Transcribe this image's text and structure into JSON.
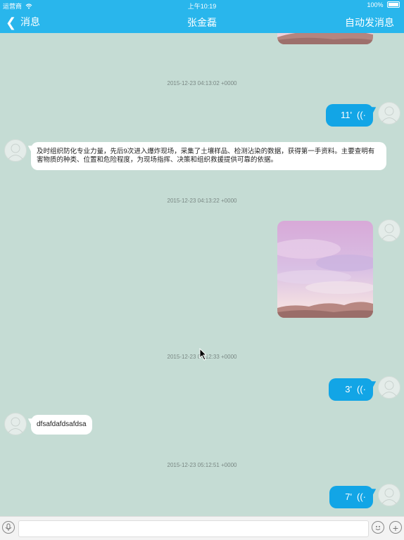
{
  "status_bar": {
    "carrier": "运营商",
    "time": "上午10:19",
    "battery": "100%"
  },
  "nav": {
    "back_label": "消息",
    "title": "张金磊",
    "right_label": "自动发消息"
  },
  "messages": [
    {
      "type": "timestamp",
      "text": "2015-12-23 04:13:02 +0000"
    },
    {
      "type": "voice",
      "direction": "out",
      "duration": "11'"
    },
    {
      "type": "text",
      "direction": "in",
      "text": "及时组织防化专业力量，先后9次进入爆炸现场，采集了土壤样品、检测沾染的数据，获得第一手资料。主要查明有害物质的种类、位置和危险程度，为现场指挥、决策和组织救援提供可靠的依据。"
    },
    {
      "type": "timestamp",
      "text": "2015-12-23 04:13:22 +0000"
    },
    {
      "type": "image",
      "direction": "out"
    },
    {
      "type": "timestamp",
      "text": "2015-12-23 04:12:33 +0000"
    },
    {
      "type": "voice",
      "direction": "out",
      "duration": "3'"
    },
    {
      "type": "text",
      "direction": "in",
      "text": "dfsafdafdsafdsa"
    },
    {
      "type": "timestamp",
      "text": "2015-12-23 05:12:51 +0000"
    },
    {
      "type": "voice",
      "direction": "out",
      "duration": "7'"
    }
  ],
  "icons": {
    "back": "chevron-left-icon",
    "wifi": "wifi-icon",
    "voice_wave": "sound-wave-icon",
    "mic": "microphone-icon",
    "emoji": "emoji-icon",
    "add": "plus-icon"
  },
  "colors": {
    "nav_bar": "#29b6ec",
    "chat_background": "#c5dcd4",
    "outgoing_bubble": "#12a5e6",
    "incoming_bubble": "#ffffff"
  }
}
